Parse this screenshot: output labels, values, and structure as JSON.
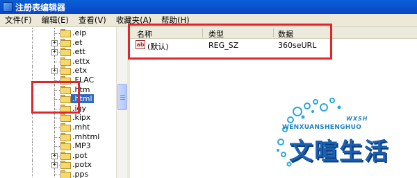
{
  "window": {
    "title": "注册表编辑器"
  },
  "menu": [
    {
      "label": "文件(F)"
    },
    {
      "label": "编辑(E)"
    },
    {
      "label": "查看(V)"
    },
    {
      "label": "收藏夹(A)"
    },
    {
      "label": "帮助(H)"
    }
  ],
  "tree": {
    "items": [
      {
        "label": ".eip",
        "expandable": false,
        "selected": false
      },
      {
        "label": ".et",
        "expandable": true,
        "selected": false
      },
      {
        "label": ".ett",
        "expandable": true,
        "selected": false
      },
      {
        "label": ".ettx",
        "expandable": false,
        "selected": false
      },
      {
        "label": ".etx",
        "expandable": true,
        "selected": false
      },
      {
        "label": ".FLAC",
        "expandable": false,
        "selected": false
      },
      {
        "label": ".htm",
        "expandable": false,
        "selected": false
      },
      {
        "label": ".html",
        "expandable": false,
        "selected": true
      },
      {
        "label": ".iqy",
        "expandable": false,
        "selected": false
      },
      {
        "label": ".kipx",
        "expandable": false,
        "selected": false
      },
      {
        "label": ".mht",
        "expandable": false,
        "selected": false
      },
      {
        "label": ".mhtml",
        "expandable": false,
        "selected": false
      },
      {
        "label": ".MP3",
        "expandable": false,
        "selected": false
      },
      {
        "label": ".pot",
        "expandable": true,
        "selected": false
      },
      {
        "label": ".potx",
        "expandable": true,
        "selected": false
      },
      {
        "label": ".pps",
        "expandable": false,
        "selected": false
      }
    ]
  },
  "values": {
    "headers": {
      "name": "名称",
      "type": "类型",
      "data": "数据"
    },
    "rows": [
      {
        "icon": "ab-string-icon",
        "icon_text": "ab",
        "name": "(默认)",
        "type": "REG_SZ",
        "data": "360seURL"
      }
    ]
  },
  "watermark": {
    "en_main": "WENXUANSHENGHUO",
    "en_small": "WXSH",
    "cn": "文暄生活"
  },
  "colors": {
    "titlebar": "#0a5fd8",
    "selection": "#316ac5",
    "annotation_red": "#e0262c",
    "logo_blue": "#1b5fb1"
  }
}
